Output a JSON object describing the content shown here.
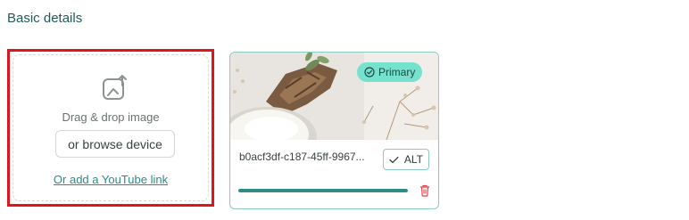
{
  "section": {
    "title": "Basic details"
  },
  "upload": {
    "icon": "image-upload-icon",
    "drag_text": "Drag & drop image",
    "browse_label": "or browse device",
    "youtube_label": "Or add a YouTube link"
  },
  "media": {
    "badge_label": "Primary",
    "badge_icon": "check-circle-icon",
    "filename": "b0acf3df-c187-45ff-9967...",
    "alt_label": "ALT",
    "alt_icon": "checkmark-icon",
    "delete_icon": "trash-icon",
    "progress": 1.0
  },
  "colors": {
    "accent": "#2e8c86",
    "badge": "#76e1cc",
    "highlight_border": "#e0151b",
    "delete": "#e0454b"
  }
}
